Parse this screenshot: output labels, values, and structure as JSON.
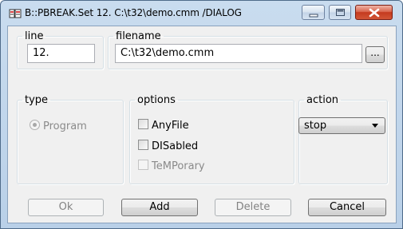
{
  "window": {
    "title": "B::PBREAK.Set 12. C:\\t32\\demo.cmm  /DIALOG",
    "icon": "trace32-app-icon"
  },
  "line_group": {
    "legend": "line",
    "value": "12."
  },
  "filename_group": {
    "legend": "filename",
    "value": "C:\\t32\\demo.cmm",
    "browse_label": "..."
  },
  "type_group": {
    "legend": "type",
    "option": "Program"
  },
  "options_group": {
    "legend": "options",
    "items": [
      "AnyFile",
      "DISabled",
      "TeMPorary"
    ]
  },
  "action_group": {
    "legend": "action",
    "selected": "stop"
  },
  "buttons": {
    "ok": "Ok",
    "add": "Add",
    "delete": "Delete",
    "cancel": "Cancel"
  }
}
